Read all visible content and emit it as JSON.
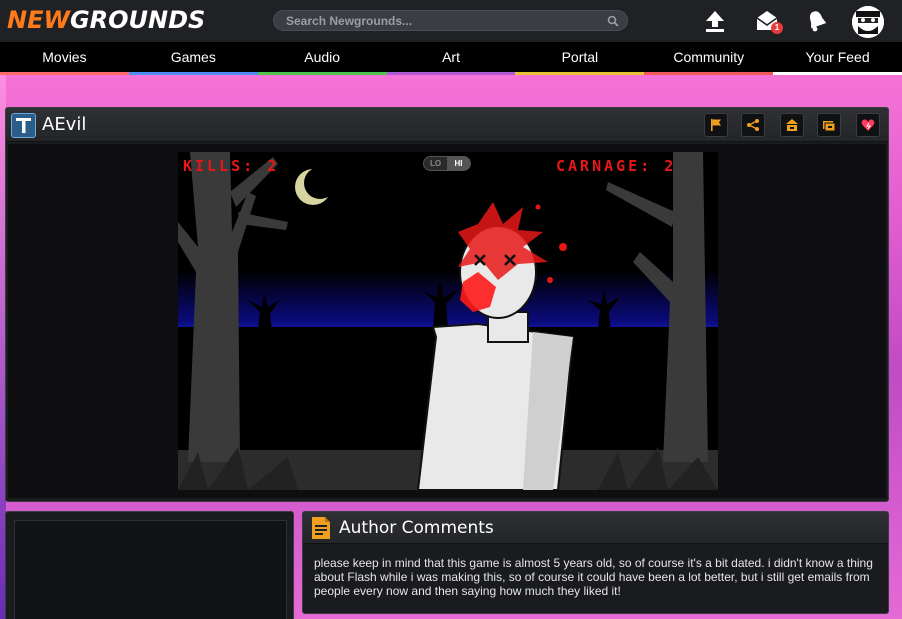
{
  "header": {
    "logo_new": "NEW",
    "logo_grounds": "GROUNDS",
    "search_placeholder": "Search Newgrounds...",
    "notification_count": "1",
    "icons": [
      "upload-icon",
      "mail-icon",
      "bell-icon",
      "avatar"
    ]
  },
  "nav": {
    "items": [
      {
        "label": "Movies",
        "color": "#ff6a6a"
      },
      {
        "label": "Games",
        "color": "#4f8df5"
      },
      {
        "label": "Audio",
        "color": "#4fc44f"
      },
      {
        "label": "Art",
        "color": "#b05ad8"
      },
      {
        "label": "Portal",
        "color": "#e8c23a"
      },
      {
        "label": "Community",
        "color": "#f05a5a"
      },
      {
        "label": "Your Feed",
        "color": "#ffffff"
      }
    ]
  },
  "game_panel": {
    "title": "AEvil",
    "toolbar_icons": [
      "flag-icon",
      "share-icon",
      "upload-to-icon",
      "favorite-folder-icon",
      "heart-icon"
    ],
    "hud": {
      "kills": "KILLS: 2",
      "carnage": "CARNAGE: 2",
      "quality_lo": "LO",
      "quality_hi": "HI"
    }
  },
  "author": {
    "title": "Author Comments",
    "text": "please keep in mind that this game is almost 5 years old, so of course it's a bit dated. i didn't know a thing about Flash while i was making this, so of course it could have been a lot better, but i still get emails from people every now and then saying how much they liked it!"
  },
  "colors": {
    "accent_orange": "#ff7a1a",
    "toolbar_icon": "#f0a020",
    "blood_red": "#e81717"
  }
}
